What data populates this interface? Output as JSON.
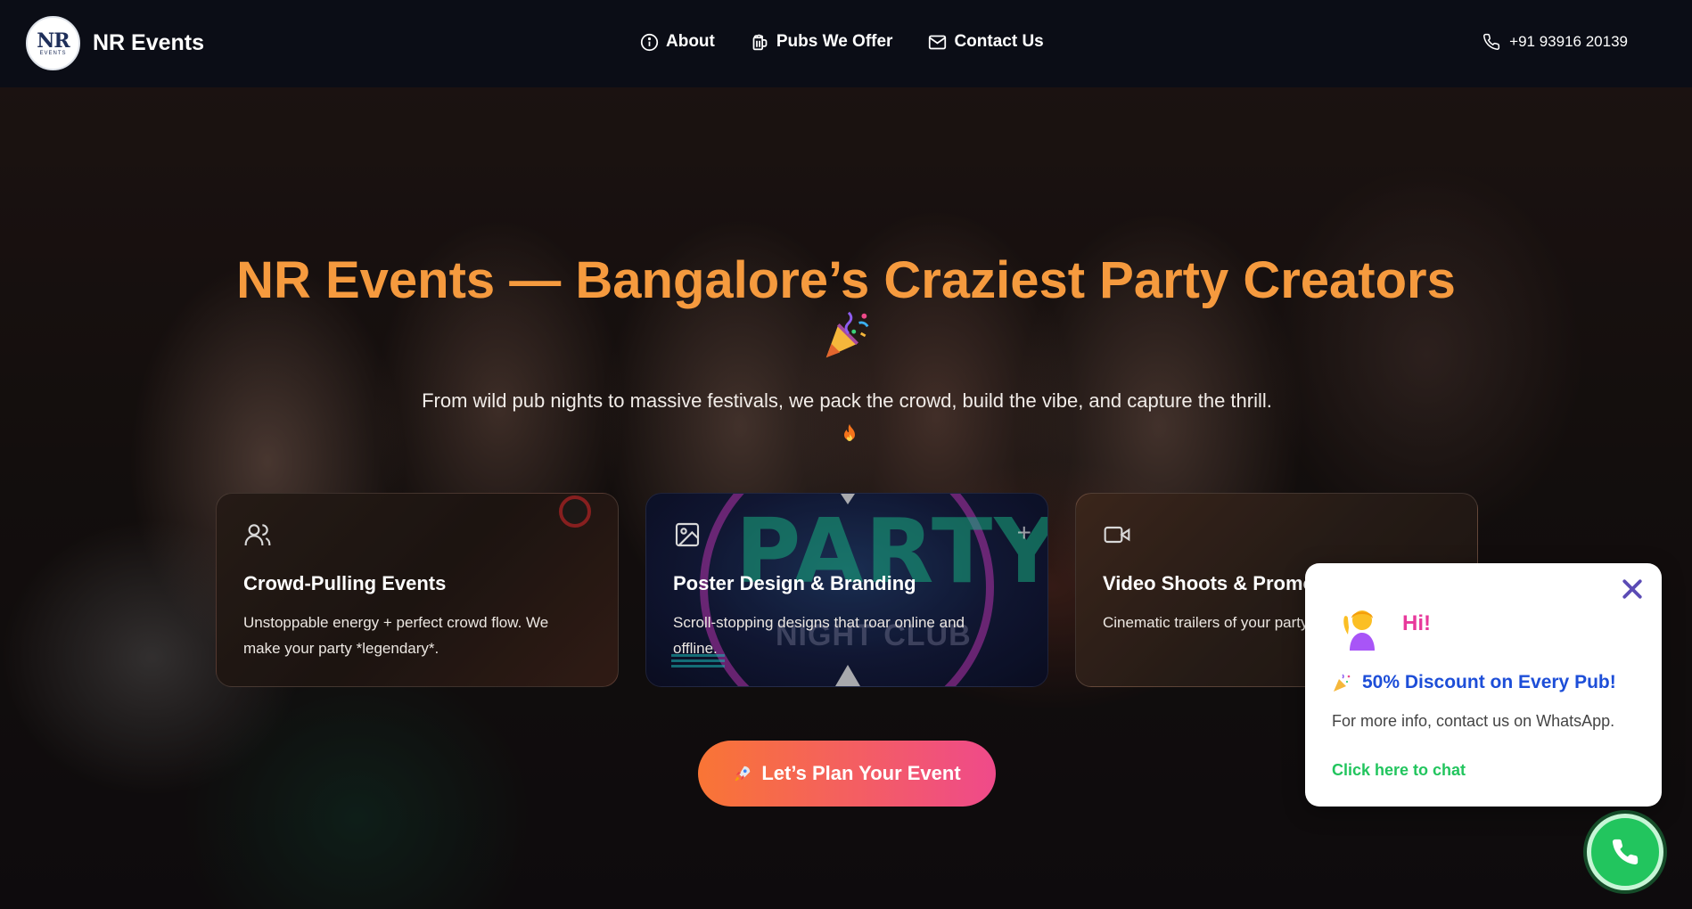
{
  "header": {
    "brand_name": "NR Events",
    "logo_mark": "NR",
    "logo_sub": "EVENTS",
    "nav": [
      {
        "label": "About",
        "icon": "info-icon"
      },
      {
        "label": "Pubs We Offer",
        "icon": "beer-mug-icon"
      },
      {
        "label": "Contact Us",
        "icon": "mail-icon"
      }
    ],
    "phone": "+91 93916 20139"
  },
  "hero": {
    "title": "NR Events — Bangalore’s Craziest Party Creators",
    "title_emoji": "party-popper-icon",
    "subtitle": "From wild pub nights to massive festivals, we pack the crowd, build the vibe, and capture the thrill.",
    "subtitle_emoji": "fire-icon"
  },
  "cards": [
    {
      "title": "Crowd-Pulling Events",
      "desc": "Unstoppable energy + perfect crowd flow. We make your party *legendary*.",
      "icon": "users-icon"
    },
    {
      "title": "Poster Design & Branding",
      "desc": "Scroll-stopping designs that roar online and offline.",
      "icon": "image-icon",
      "bg_word_1": "PARTY",
      "bg_word_2": "NIGHT CLUB"
    },
    {
      "title": "Video Shoots & Promos",
      "desc": "Cinematic trailers of your party. Everything.",
      "icon": "video-camera-icon"
    }
  ],
  "cta": {
    "label": "Let’s Plan Your Event",
    "icon": "rocket-icon"
  },
  "popup": {
    "greeting": "Hi!",
    "discount": "50% Discount on Every Pub!",
    "info": "For more info, contact us on WhatsApp.",
    "link": "Click here to chat"
  },
  "colors": {
    "title_orange": "#f59a3e",
    "cta_start": "#f97535",
    "cta_end": "#ef4a8a",
    "popup_pink": "#e8399b",
    "popup_blue": "#1d4ed8",
    "whatsapp_green": "#22c55e"
  }
}
